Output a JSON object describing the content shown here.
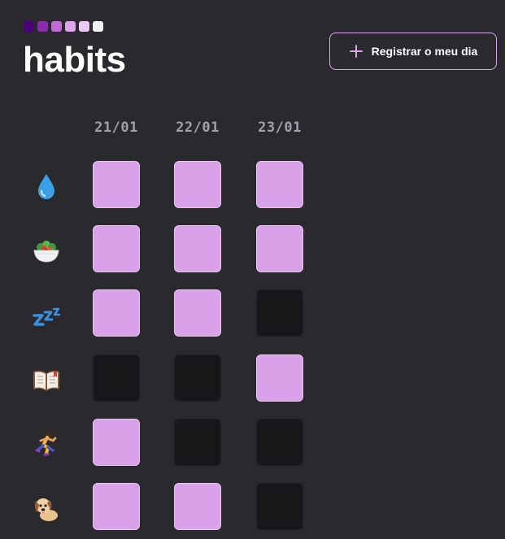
{
  "header": {
    "title": "habits",
    "logo_colors": [
      "#4b0077",
      "#8a2ba8",
      "#c06ad6",
      "#dca4ea",
      "#ebc9f4",
      "#f3f3f5"
    ],
    "register_label": "Registrar o meu dia",
    "register_icon": "plus-icon"
  },
  "dates": [
    "21/01",
    "22/01",
    "23/01"
  ],
  "habits": [
    {
      "name": "water",
      "icon": "water-drop-icon",
      "done": [
        true,
        true,
        true
      ]
    },
    {
      "name": "salad",
      "icon": "salad-bowl-icon",
      "done": [
        true,
        true,
        true
      ]
    },
    {
      "name": "sleep",
      "icon": "zzz-sleep-icon",
      "done": [
        true,
        true,
        false
      ]
    },
    {
      "name": "read",
      "icon": "open-book-icon",
      "done": [
        false,
        false,
        true
      ]
    },
    {
      "name": "run",
      "icon": "runner-icon",
      "done": [
        true,
        false,
        false
      ]
    },
    {
      "name": "dog",
      "icon": "dog-icon",
      "done": [
        true,
        true,
        false
      ]
    }
  ],
  "colors": {
    "done": "#d9a1e8",
    "not_done": "#18181b",
    "accent": "#d9a6ea"
  }
}
